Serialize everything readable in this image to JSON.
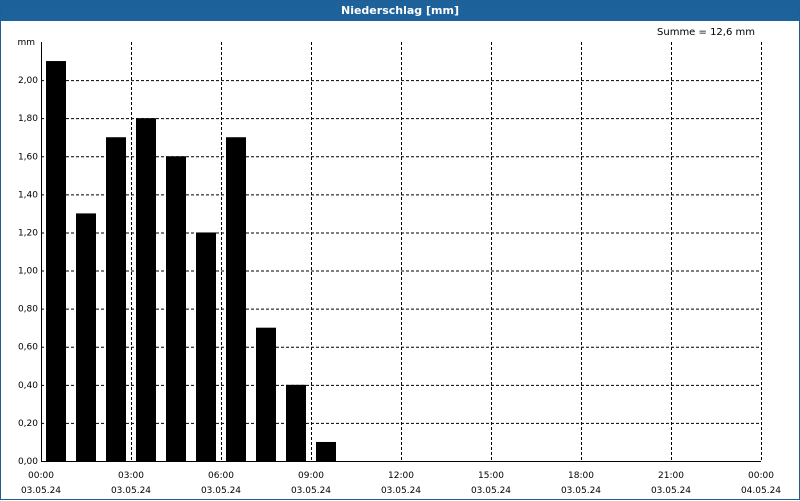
{
  "window": {
    "title": "Niederschlag [mm]"
  },
  "summary": {
    "label": "Summe = 12,6 mm"
  },
  "colors": {
    "titlebar": "#1e629c",
    "bars": "#000000",
    "grid": "#000000"
  },
  "chart_data": {
    "type": "bar",
    "title": "Niederschlag [mm]",
    "ylabel": "mm",
    "ylim": [
      0,
      2.2
    ],
    "yticks": [
      "0,00",
      "0,20",
      "0,40",
      "0,60",
      "0,80",
      "1,00",
      "1,20",
      "1,40",
      "1,60",
      "1,80",
      "2,00"
    ],
    "ytick_values": [
      0,
      0.2,
      0.4,
      0.6,
      0.8,
      1.0,
      1.2,
      1.4,
      1.6,
      1.8,
      2.0
    ],
    "xticks": [
      {
        "time": "00:00",
        "date": "03.05.24"
      },
      {
        "time": "03:00",
        "date": "03.05.24"
      },
      {
        "time": "06:00",
        "date": "03.05.24"
      },
      {
        "time": "09:00",
        "date": "03.05.24"
      },
      {
        "time": "12:00",
        "date": "03.05.24"
      },
      {
        "time": "15:00",
        "date": "03.05.24"
      },
      {
        "time": "18:00",
        "date": "03.05.24"
      },
      {
        "time": "21:00",
        "date": "03.05.24"
      },
      {
        "time": "00:00",
        "date": "04.05.24"
      }
    ],
    "xlim_hours": [
      0,
      24
    ],
    "series": [
      {
        "x_hours": [
          0.5,
          1.5,
          2.5,
          3.5,
          4.5,
          5.5,
          6.5,
          7.5,
          8.5,
          9.5
        ],
        "values": [
          2.1,
          1.3,
          1.7,
          1.8,
          1.6,
          1.2,
          1.7,
          0.7,
          0.4,
          0.1
        ]
      }
    ],
    "grid": true,
    "legend": "none"
  }
}
